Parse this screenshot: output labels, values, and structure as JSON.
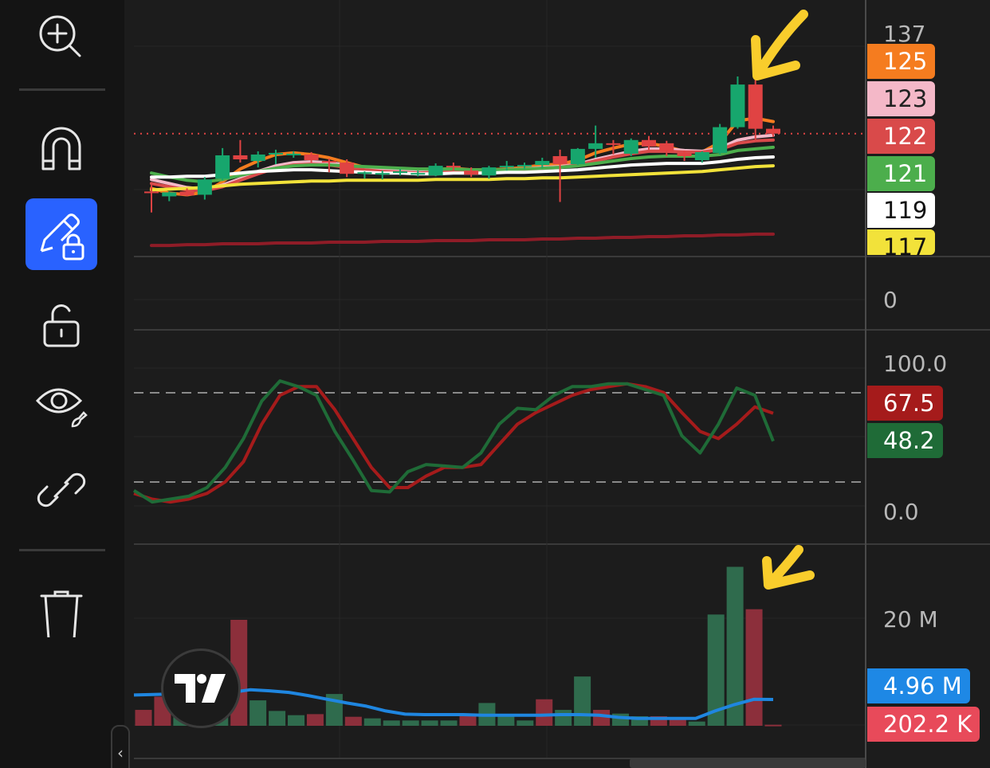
{
  "toolbar": {
    "tools": [
      {
        "id": "zoom-in",
        "icon": "zoom-in-icon",
        "active": false
      },
      {
        "id": "magnet",
        "icon": "magnet-icon",
        "active": false
      },
      {
        "id": "lock-drawings",
        "icon": "pencil-lock-icon",
        "active": true
      },
      {
        "id": "unlock",
        "icon": "unlock-icon",
        "active": false
      },
      {
        "id": "hide-drawings",
        "icon": "eye-brush-icon",
        "active": false
      },
      {
        "id": "link",
        "icon": "link-icon",
        "active": false
      },
      {
        "id": "delete",
        "icon": "trash-icon",
        "active": false
      }
    ],
    "collapse_label": "‹"
  },
  "colors": {
    "up_candle": "#17a66d",
    "down_candle": "#e04343",
    "ma_orange": "#f57c1f",
    "ma_pink": "#f4b8c8",
    "ma_red": "#d94a4a",
    "ma_green": "#4cae4c",
    "ma_white": "#ffffff",
    "ma_yellow": "#f2e23a",
    "ma_maroon": "#8f1c27",
    "stoch_k": "#1f6b37",
    "stoch_d": "#a51b1b",
    "vol_ma": "#1f86e0",
    "vol_up": "#2f6b4d",
    "vol_down": "#8c2f3b",
    "annotation": "#f9cd2c",
    "accent": "#2962ff"
  },
  "price_pane": {
    "axis_labels": [
      "137",
      "0"
    ],
    "badges": [
      {
        "value": "125",
        "bg": "#f57c1f",
        "fg": "#ffffff"
      },
      {
        "value": "123",
        "bg": "#f4b8c8",
        "fg": "#222222"
      },
      {
        "value": "122",
        "bg": "#d94a4a",
        "fg": "#ffffff"
      },
      {
        "value": "121",
        "bg": "#4cae4c",
        "fg": "#ffffff"
      },
      {
        "value": "119",
        "bg": "#ffffff",
        "fg": "#111111"
      },
      {
        "value": "117",
        "bg": "#f2e23a",
        "fg": "#111111"
      }
    ]
  },
  "stoch_pane": {
    "axis_labels": [
      "100.0",
      "0.0"
    ],
    "badges": [
      {
        "value": "67.5",
        "bg": "#a51b1b",
        "fg": "#ffffff"
      },
      {
        "value": "48.2",
        "bg": "#1f6b37",
        "fg": "#ffffff"
      }
    ]
  },
  "volume_pane": {
    "axis_labels": [
      "20 M"
    ],
    "badges": [
      {
        "value": "4.96 M",
        "bg": "#1e88e5",
        "fg": "#ffffff"
      },
      {
        "value": "202.2 K",
        "bg": "#e84a5a",
        "fg": "#ffffff"
      }
    ]
  },
  "chart_data": {
    "type": "candlestick",
    "price_axis": {
      "labels": [
        "137"
      ],
      "ylim": [
        108,
        138
      ]
    },
    "candles": [
      {
        "o": 116.0,
        "h": 116.8,
        "l": 113.4,
        "c": 115.8
      },
      {
        "o": 115.4,
        "h": 116.0,
        "l": 114.8,
        "c": 115.9
      },
      {
        "o": 116.0,
        "h": 116.4,
        "l": 115.4,
        "c": 115.5
      },
      {
        "o": 115.6,
        "h": 117.8,
        "l": 115.0,
        "c": 117.5
      },
      {
        "o": 117.6,
        "h": 121.4,
        "l": 117.4,
        "c": 120.5
      },
      {
        "o": 120.5,
        "h": 122.4,
        "l": 119.6,
        "c": 120.0
      },
      {
        "o": 119.8,
        "h": 121.0,
        "l": 119.0,
        "c": 120.6
      },
      {
        "o": 120.6,
        "h": 121.2,
        "l": 119.4,
        "c": 120.8
      },
      {
        "o": 120.7,
        "h": 121.0,
        "l": 120.2,
        "c": 120.7
      },
      {
        "o": 120.6,
        "h": 120.9,
        "l": 119.6,
        "c": 119.9
      },
      {
        "o": 119.8,
        "h": 120.1,
        "l": 118.4,
        "c": 119.6
      },
      {
        "o": 119.6,
        "h": 120.0,
        "l": 117.8,
        "c": 118.2
      },
      {
        "o": 118.2,
        "h": 118.5,
        "l": 117.6,
        "c": 118.4
      },
      {
        "o": 118.3,
        "h": 118.6,
        "l": 117.5,
        "c": 118.3
      },
      {
        "o": 118.3,
        "h": 118.8,
        "l": 118.0,
        "c": 118.5
      },
      {
        "o": 118.3,
        "h": 118.6,
        "l": 117.9,
        "c": 118.3
      },
      {
        "o": 118.0,
        "h": 119.5,
        "l": 117.9,
        "c": 119.2
      },
      {
        "o": 119.2,
        "h": 119.6,
        "l": 118.6,
        "c": 119.1
      },
      {
        "o": 118.6,
        "h": 119.0,
        "l": 117.8,
        "c": 118.1
      },
      {
        "o": 118.0,
        "h": 119.2,
        "l": 117.6,
        "c": 119.0
      },
      {
        "o": 119.0,
        "h": 119.8,
        "l": 118.6,
        "c": 119.2
      },
      {
        "o": 119.1,
        "h": 119.6,
        "l": 118.8,
        "c": 119.3
      },
      {
        "o": 119.3,
        "h": 120.2,
        "l": 118.9,
        "c": 119.8
      },
      {
        "o": 120.4,
        "h": 121.2,
        "l": 114.7,
        "c": 119.4
      },
      {
        "o": 119.4,
        "h": 121.4,
        "l": 119.3,
        "c": 121.3
      },
      {
        "o": 121.3,
        "h": 124.2,
        "l": 120.2,
        "c": 122.0
      },
      {
        "o": 122.0,
        "h": 122.4,
        "l": 120.6,
        "c": 121.9
      },
      {
        "o": 120.7,
        "h": 122.6,
        "l": 120.4,
        "c": 122.4
      },
      {
        "o": 122.4,
        "h": 122.9,
        "l": 121.2,
        "c": 121.6
      },
      {
        "o": 122.0,
        "h": 122.3,
        "l": 120.4,
        "c": 121.0
      },
      {
        "o": 120.8,
        "h": 121.1,
        "l": 119.8,
        "c": 120.4
      },
      {
        "o": 119.9,
        "h": 121.0,
        "l": 119.6,
        "c": 120.9
      },
      {
        "o": 120.8,
        "h": 124.4,
        "l": 120.6,
        "c": 124.0
      },
      {
        "o": 124.0,
        "h": 130.3,
        "l": 123.8,
        "c": 129.3
      },
      {
        "o": 129.3,
        "h": 130.0,
        "l": 122.4,
        "c": 123.8
      },
      {
        "o": 123.8,
        "h": 124.2,
        "l": 122.8,
        "c": 123.2
      }
    ],
    "last_price": 123.2,
    "moving_averages": [
      {
        "color": "#f57c1f",
        "values": [
          116.4,
          115.8,
          115.6,
          115.9,
          117.2,
          118.8,
          119.8,
          120.6,
          120.8,
          120.6,
          120.2,
          119.6,
          119.0,
          118.7,
          118.5,
          118.4,
          118.7,
          118.9,
          118.7,
          118.7,
          118.8,
          119.0,
          119.3,
          119.4,
          119.9,
          120.8,
          121.4,
          121.9,
          122.0,
          121.6,
          121.0,
          120.9,
          122.1,
          124.8,
          125.1,
          124.7
        ]
      },
      {
        "color": "#f4b8c8",
        "values": [
          117.5,
          117.0,
          116.5,
          116.3,
          116.8,
          117.6,
          118.5,
          119.2,
          119.6,
          119.7,
          119.6,
          119.3,
          119.0,
          118.8,
          118.6,
          118.5,
          118.6,
          118.7,
          118.6,
          118.6,
          118.7,
          118.8,
          119.0,
          119.1,
          119.4,
          120.0,
          120.5,
          121.0,
          121.3,
          121.3,
          121.1,
          121.0,
          121.4,
          122.4,
          122.8,
          123.0
        ]
      },
      {
        "color": "#d94a4a",
        "values": [
          117.0,
          116.6,
          116.2,
          116.1,
          116.6,
          117.4,
          118.2,
          118.9,
          119.3,
          119.4,
          119.3,
          119.0,
          118.7,
          118.5,
          118.4,
          118.3,
          118.4,
          118.5,
          118.5,
          118.5,
          118.6,
          118.7,
          118.9,
          119.0,
          119.3,
          119.8,
          120.3,
          120.7,
          121.0,
          121.0,
          120.9,
          120.9,
          121.2,
          122.0,
          122.3,
          122.4
        ]
      },
      {
        "color": "#4cae4c",
        "values": [
          118.3,
          117.8,
          117.4,
          117.2,
          117.5,
          118.0,
          118.5,
          118.9,
          119.2,
          119.3,
          119.3,
          119.2,
          119.1,
          119.0,
          118.9,
          118.8,
          118.8,
          118.8,
          118.7,
          118.7,
          118.7,
          118.8,
          118.9,
          119.0,
          119.2,
          119.5,
          119.8,
          120.1,
          120.3,
          120.4,
          120.4,
          120.4,
          120.6,
          121.1,
          121.3,
          121.5
        ]
      },
      {
        "color": "#ffffff",
        "values": [
          117.8,
          117.8,
          117.9,
          117.9,
          118.1,
          118.3,
          118.5,
          118.6,
          118.7,
          118.7,
          118.6,
          118.5,
          118.4,
          118.3,
          118.3,
          118.2,
          118.2,
          118.3,
          118.3,
          118.3,
          118.4,
          118.4,
          118.5,
          118.6,
          118.7,
          118.9,
          119.1,
          119.3,
          119.4,
          119.5,
          119.5,
          119.5,
          119.7,
          120.0,
          120.2,
          120.3
        ]
      },
      {
        "color": "#f2e23a",
        "values": [
          116.2,
          116.3,
          116.4,
          116.5,
          116.7,
          116.9,
          117.0,
          117.1,
          117.2,
          117.3,
          117.3,
          117.4,
          117.4,
          117.4,
          117.4,
          117.4,
          117.5,
          117.5,
          117.5,
          117.5,
          117.6,
          117.6,
          117.7,
          117.7,
          117.8,
          117.9,
          118.0,
          118.1,
          118.2,
          118.3,
          118.4,
          118.5,
          118.7,
          118.9,
          119.1,
          119.2
        ]
      },
      {
        "color": "#8f1c27",
        "values": [
          109.3,
          109.3,
          109.4,
          109.4,
          109.5,
          109.5,
          109.5,
          109.6,
          109.6,
          109.6,
          109.7,
          109.7,
          109.7,
          109.8,
          109.8,
          109.8,
          109.9,
          109.9,
          109.9,
          110.0,
          110.0,
          110.0,
          110.1,
          110.1,
          110.2,
          110.2,
          110.3,
          110.3,
          110.4,
          110.4,
          110.5,
          110.5,
          110.6,
          110.6,
          110.7,
          110.7
        ]
      }
    ],
    "stochastic": {
      "axis": [
        "100.0",
        "0.0"
      ],
      "k": [
        14,
        6,
        8,
        10,
        16,
        30,
        50,
        76,
        90,
        86,
        80,
        55,
        35,
        14,
        13,
        27,
        32,
        31,
        30,
        40,
        60,
        71,
        70,
        80,
        86,
        86,
        88,
        88,
        84,
        80,
        52,
        40,
        60,
        85,
        80,
        48.2
      ],
      "d": [
        12,
        8,
        6,
        8,
        12,
        20,
        34,
        60,
        80,
        86,
        86,
        70,
        50,
        30,
        16,
        16,
        24,
        30,
        30,
        32,
        46,
        60,
        68,
        74,
        80,
        84,
        86,
        88,
        86,
        82,
        68,
        55,
        50,
        60,
        72,
        67.5
      ]
    },
    "volume": {
      "axis": [
        "20 M"
      ],
      "bars": [
        3,
        5.5,
        3.2,
        6,
        3.5,
        20,
        4.8,
        2.8,
        2,
        2.2,
        6,
        1.7,
        1.4,
        1.0,
        1.0,
        1.0,
        1.0,
        2.2,
        4.3,
        1.8,
        1.0,
        5.0,
        3.0,
        9.3,
        3.0,
        2.3,
        1.8,
        1.8,
        1.6,
        0.8,
        21,
        30,
        22,
        0.2
      ],
      "bar_dir": [
        "down",
        "down",
        "up",
        "up",
        "up",
        "down",
        "up",
        "up",
        "up",
        "down",
        "up",
        "down",
        "up",
        "up",
        "up",
        "up",
        "up",
        "down",
        "up",
        "up",
        "up",
        "down",
        "up",
        "up",
        "down",
        "up",
        "up",
        "down",
        "down",
        "up",
        "up",
        "up",
        "down",
        "down"
      ],
      "ma": [
        5.8,
        5.9,
        6.0,
        6.1,
        6.2,
        6.3,
        6.8,
        6.6,
        6.3,
        5.7,
        5.0,
        4.3,
        3.7,
        2.8,
        2.2,
        2.1,
        2.1,
        2.1,
        2.0,
        2.0,
        2.0,
        2.0,
        2.1,
        2.1,
        2.0,
        1.6,
        1.4,
        1.4,
        1.4,
        1.4,
        2.8,
        4.0,
        5.0,
        4.96
      ]
    }
  }
}
